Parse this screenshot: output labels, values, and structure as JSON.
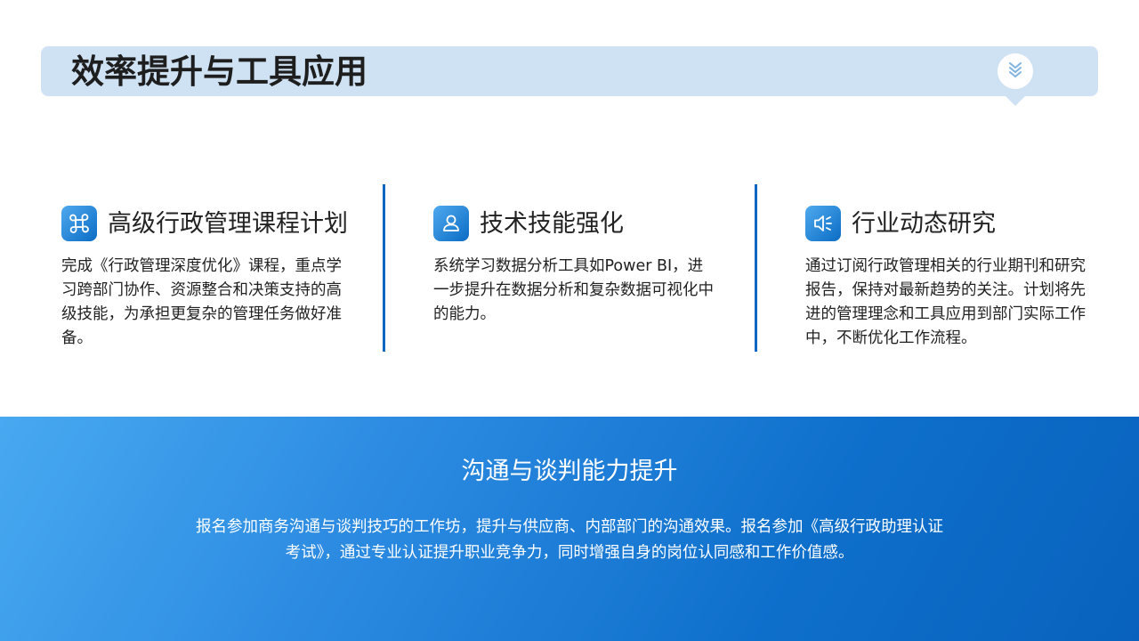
{
  "header": {
    "title": "效率提升与工具应用",
    "badge_icon": "double-chevron-down-icon"
  },
  "columns": [
    {
      "icon": "command-icon",
      "title": "高级行政管理课程计划",
      "text": "完成《行政管理深度优化》课程，重点学习跨部门协作、资源整合和决策支持的高级技能，为承担更复杂的管理任务做好准备。"
    },
    {
      "icon": "user-icon",
      "title": "技术技能强化",
      "text": "系统学习数据分析工具如Power BI，进一步提升在数据分析和复杂数据可视化中的能力。"
    },
    {
      "icon": "speaker-icon",
      "title": "行业动态研究",
      "text": "通过订阅行政管理相关的行业期刊和研究报告，保持对最新趋势的关注。计划将先进的管理理念和工具应用到部门实际工作中，不断优化工作流程。"
    }
  ],
  "bottom": {
    "title": "沟通与谈判能力提升",
    "text": "报名参加商务沟通与谈判技巧的工作坊，提升与供应商、内部部门的沟通效果。报名参加《高级行政助理认证考试》，通过专业认证提升职业竞争力，同时增强自身的岗位认同感和工作价值感。"
  },
  "colors": {
    "header_bar": "#cfe2f3",
    "accent": "#1067c2",
    "gradient_start": "#48a9f1",
    "gradient_end": "#0862bd"
  }
}
